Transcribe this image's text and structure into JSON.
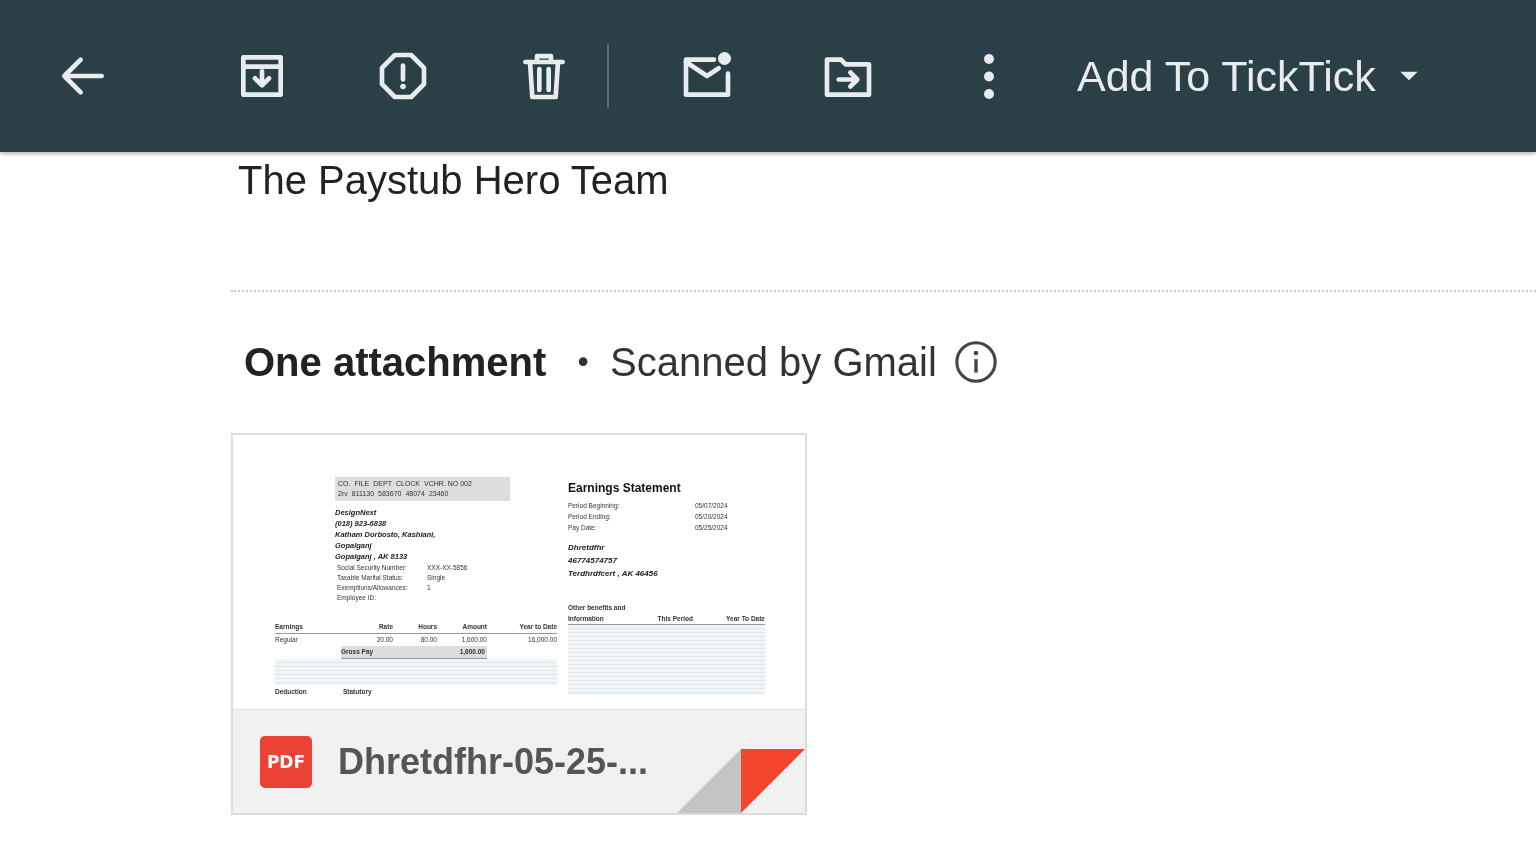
{
  "toolbar": {
    "menu_label": "Add To TickTick"
  },
  "signature": "The Paystub Hero Team",
  "attachments": {
    "heading": "One attachment",
    "separator": "•",
    "scan_note": "Scanned by Gmail",
    "items": [
      {
        "file_type": "PDF",
        "file_name": "Dhretdfhr-05-25-...",
        "preview": {
          "codes": {
            "headers": [
              "CO.",
              "FILE",
              "DEPT",
              "CLOCK",
              "VCHR. NO 002"
            ],
            "values": [
              "2rv",
              "811130",
              "583670",
              "48074",
              "23460"
            ]
          },
          "employer_lines": [
            "DesignNext",
            "(018) 923-6838",
            "Katham Dorbosto, Kashiani,",
            "Gopalganj",
            "Gopalganj , AK 8133"
          ],
          "employee_info": [
            {
              "label": "Social Security Number:",
              "value": "XXX-XX-5856"
            },
            {
              "label": "Taxable Marital Status:",
              "value": "Single"
            },
            {
              "label": "Exemptions/Allowances:",
              "value": "1"
            },
            {
              "label": "Employee ID:"
            }
          ],
          "title": "Earnings Statement",
          "periods": [
            {
              "label": "Period Beginning:",
              "value": "05/07/2024"
            },
            {
              "label": "Period Ending:",
              "value": "05/20/2024"
            },
            {
              "label": "Pay Date:",
              "value": "05/25/2024"
            }
          ],
          "employee_lines": [
            "Dhretdfhr",
            "46774574757",
            "Terdhrdfcert , AK 46456"
          ],
          "earnings": {
            "columns": [
              "Earnings",
              "Rate",
              "Hours",
              "Amount",
              "Year to Date"
            ],
            "rows": [
              [
                "Regular",
                "20.00",
                "80.00",
                "1,600.00",
                "16,000.00"
              ]
            ],
            "total": {
              "label": "Gross Pay",
              "amount": "1,600.00"
            }
          },
          "benefits": {
            "caption": "Other benefits and",
            "columns": [
              "Information",
              "This Period",
              "Year To Date"
            ]
          },
          "next_section": [
            "Deduction",
            "Statutory"
          ]
        }
      }
    ]
  }
}
